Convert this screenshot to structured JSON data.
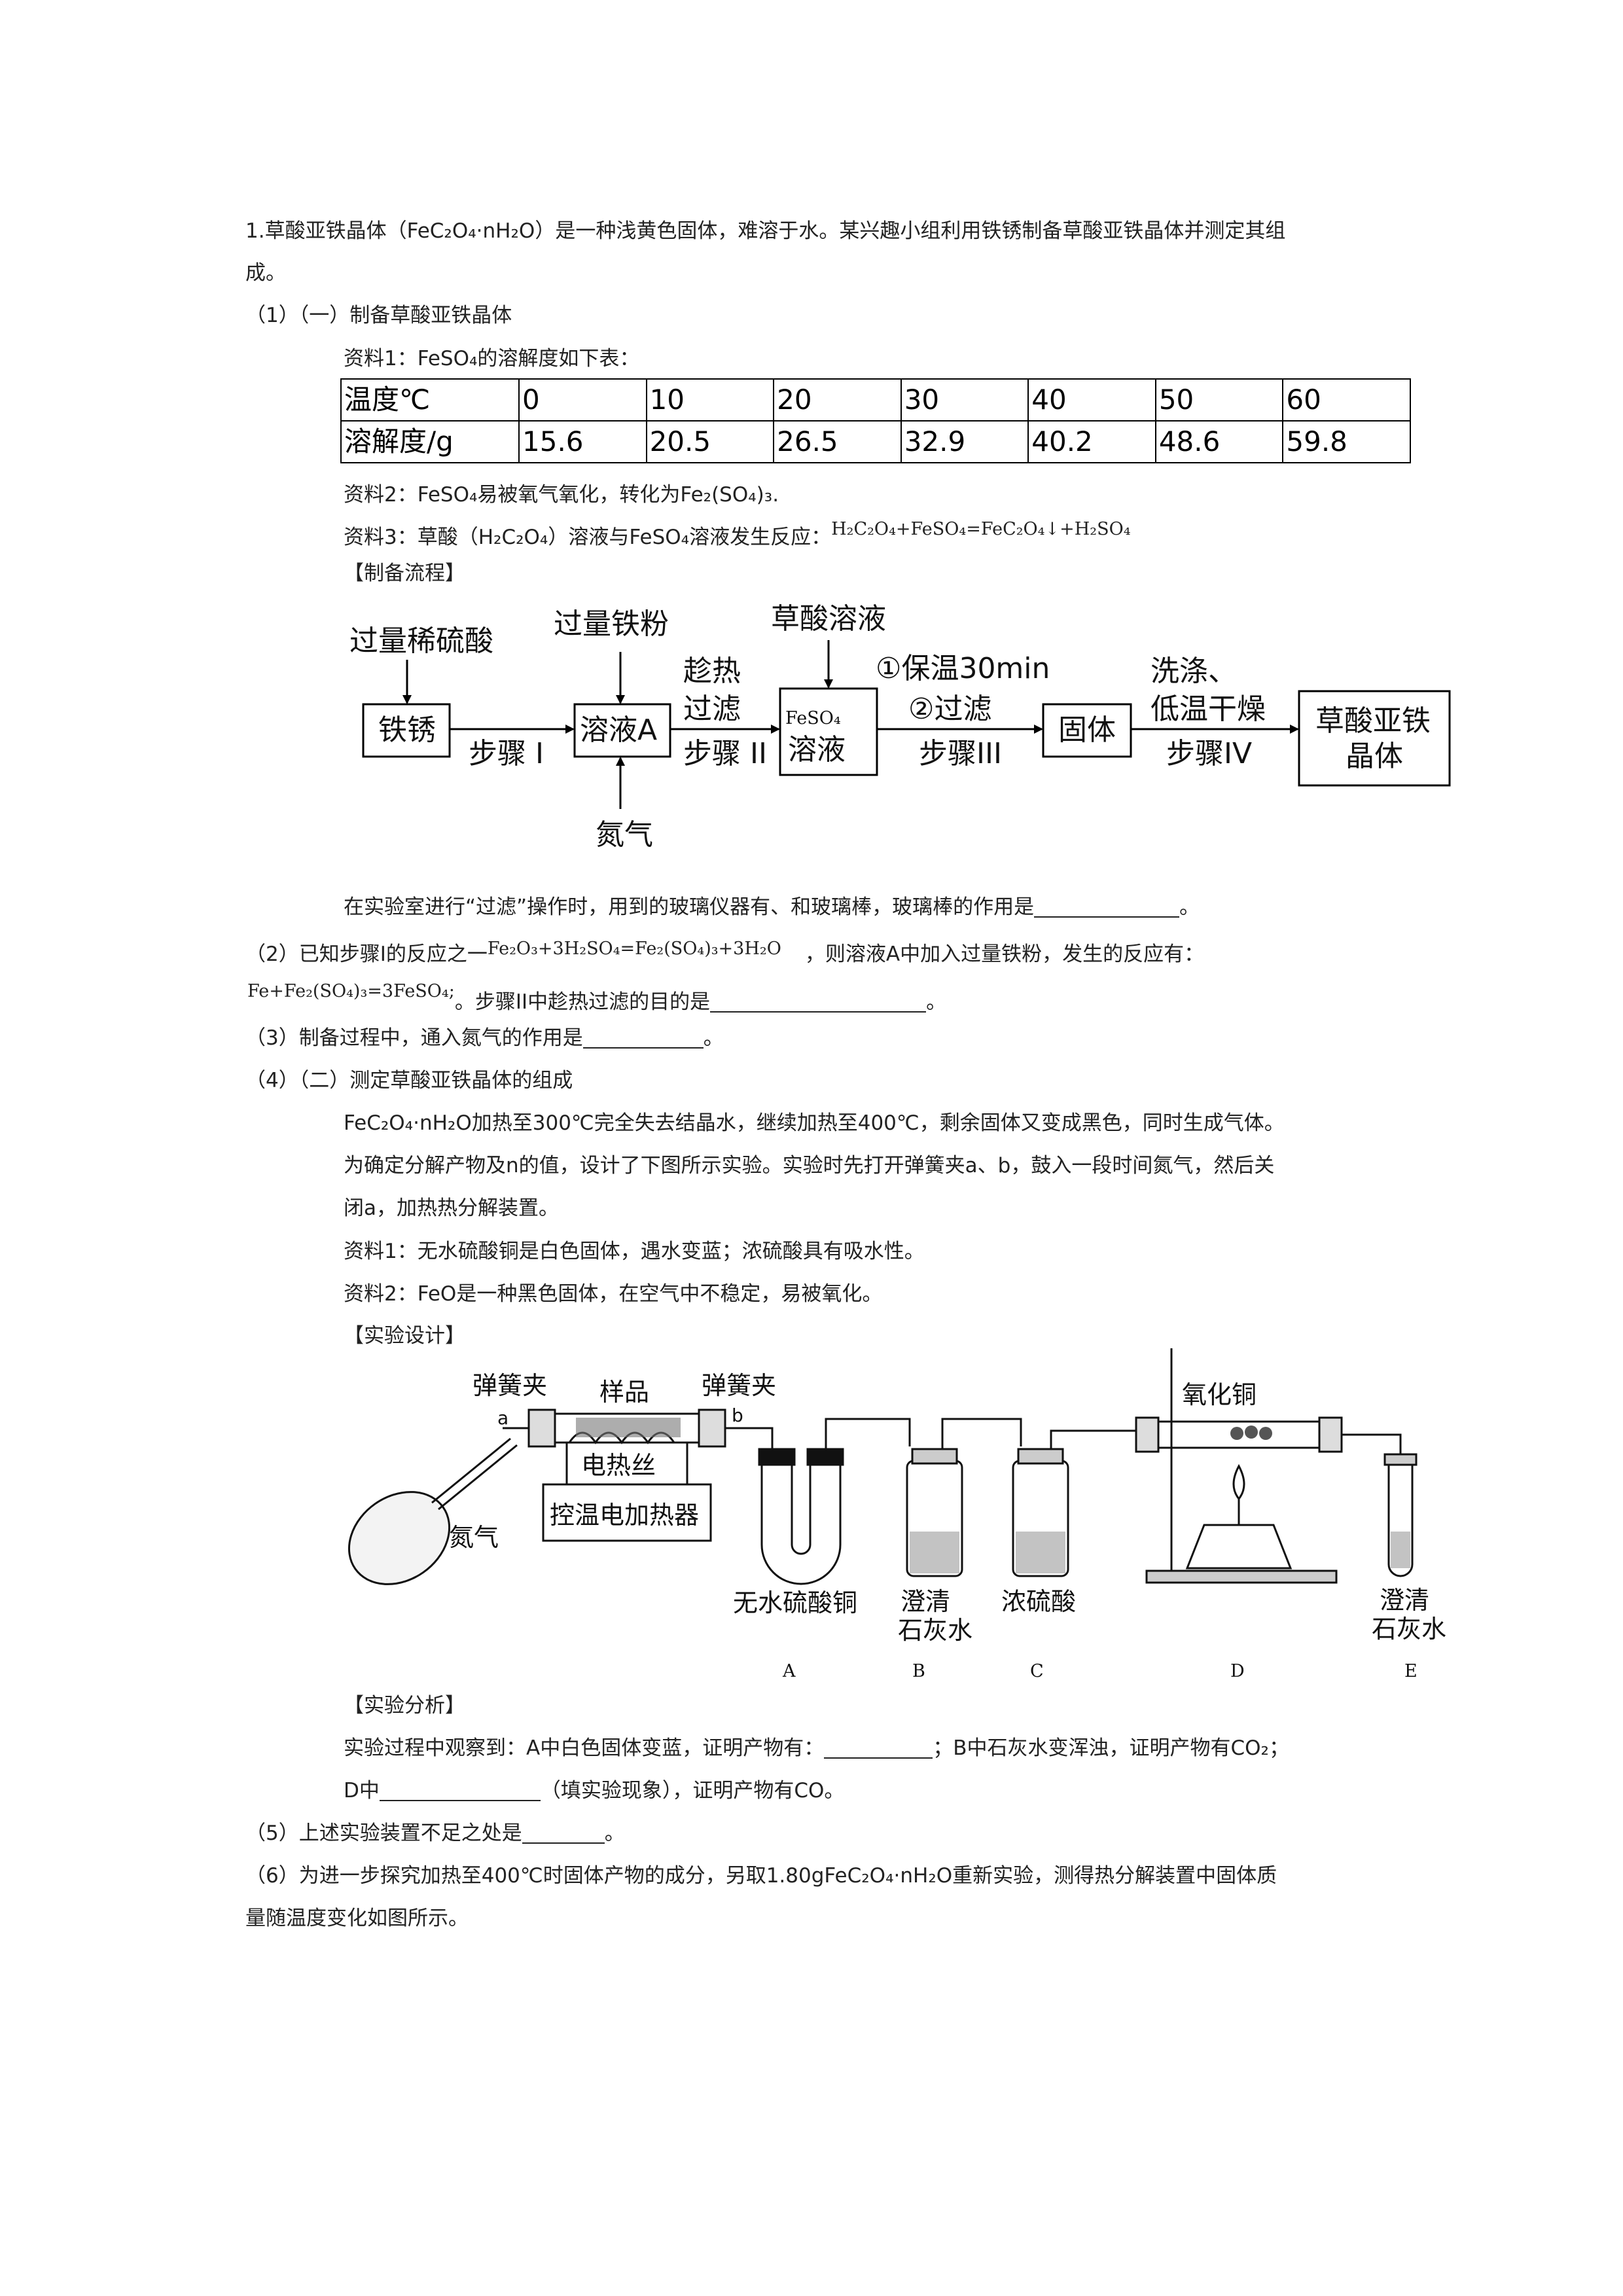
{
  "question": {
    "intro_line1": "1.草酸亚铁晶体（FeC₂O₄·nH₂O）是一种浅黄色固体，难溶于水。某兴趣小组利用铁锈制备草酸亚铁晶体并测定其组",
    "intro_line2": "成。",
    "part1_heading": "（1）（一）制备草酸亚铁晶体",
    "ref1_prefix": "资料1：FeSO₄的溶解度如下表：",
    "table": {
      "row1_header": "温度℃",
      "row1_values": [
        "0",
        "10",
        "20",
        "30",
        "40",
        "50",
        "60"
      ],
      "row2_header": "溶解度/g",
      "row2_values": [
        "15.6",
        "20.5",
        "26.5",
        "32.9",
        "40.2",
        "48.6",
        "59.8"
      ]
    },
    "ref2": "资料2：FeSO₄易被氧气氧化，转化为Fe₂(SO₄)₃.",
    "ref3_text": "资料3：草酸（H₂C₂O₄）溶液与FeSO₄溶液发生反应：",
    "ref3_equation": "H₂C₂O₄+FeSO₄=FeC₂O₄↓+H₂SO₄",
    "flow_heading": "【制备流程】",
    "flow": {
      "reagent1": "过量稀硫酸",
      "reagent2": "过量铁粉",
      "reagent3": "草酸溶液",
      "box1": "铁锈",
      "box2": "溶液A",
      "box3_top": "FeSO₄",
      "box3_bottom": "溶液",
      "box4": "固体",
      "box5_top": "草酸亚铁",
      "box5_bottom": "晶体",
      "step1": "步骤 I",
      "step2_top": "趁热",
      "step2_mid": "过滤",
      "step2_bottom": "步骤 II",
      "step3_top": "①保温30min",
      "step3_mid": "②过滤",
      "step3_bottom": "步骤III",
      "step4_top": "洗涤、",
      "step4_mid": "低温干燥",
      "step4_bottom": "步骤IV",
      "gas": "氮气"
    },
    "filter_q_a": "在实验室进行“过滤”操作时，用到的玻璃仪器有、和玻璃棒，玻璃棒的作用是",
    "filter_q_b": "。",
    "part2_a": "（2）已知步骤I的反应之一",
    "part2_eq1": "Fe₂O₃+3H₂SO₄=Fe₂(SO₄)₃+3H₂O",
    "part2_b": "，则溶液A中加入过量铁粉，发生的反应有：",
    "part2_eq2": "Fe+Fe₂(SO₄)₃=3FeSO₄;",
    "part2_c": "。步骤II中趁热过滤的目的是",
    "part2_d": "。",
    "part3_a": "（3）制备过程中，通入氮气的作用是",
    "part3_b": "。",
    "part4_heading": "（4）（二）测定草酸亚铁晶体的组成",
    "p4_line1": "FeC₂O₄·nH₂O加热至300℃完全失去结晶水，继续加热至400℃，剩余固体又变成黑色，同时生成气体。",
    "p4_line2": "为确定分解产物及n的值，设计了下图所示实验。实验时先打开弹簧夹a、b，鼓入一段时间氮气，然后关",
    "p4_line3": "闭a，加热热分解装置。",
    "p4_ref1": "资料1：无水硫酸铜是白色固体，遇水变蓝；浓硫酸具有吸水性。",
    "p4_ref2": "资料2：FeO是一种黑色固体，在空气中不稳定，易被氧化。",
    "design_heading": "【实验设计】",
    "apparatus": {
      "clip_a_label": "弹簧夹",
      "clip_a_letter": "a",
      "sample": "样品",
      "clip_b_label": "弹簧夹",
      "clip_b_letter": "b",
      "heater_wire": "电热丝",
      "heater": "控温电加热器",
      "nitrogen": "氮气",
      "cuo": "氧化铜",
      "a_label": "无水硫酸铜",
      "b_label_1": "澄清",
      "b_label_2": "石灰水",
      "c_label": "浓硫酸",
      "e_label_1": "澄清",
      "e_label_2": "石灰水",
      "letters": [
        "A",
        "B",
        "C",
        "D",
        "E"
      ]
    },
    "analysis_heading": "【实验分析】",
    "an_line1_a": "实验过程中观察到：A中白色固体变蓝，证明产物有：",
    "an_line1_b": "；B中石灰水变浑浊，证明产物有CO₂；",
    "an_line2_a": "D中",
    "an_line2_b": "（填实验现象），证明产物有CO。",
    "part5_a": "（5）上述实验装置不足之处是",
    "part5_b": "。",
    "part6_line1": "（6）为进一步探究加热至400℃时固体产物的成分，另取1.80gFeC₂O₄·nH₂O重新实验，测得热分解装置中固体质",
    "part6_line2": "量随温度变化如图所示。"
  }
}
